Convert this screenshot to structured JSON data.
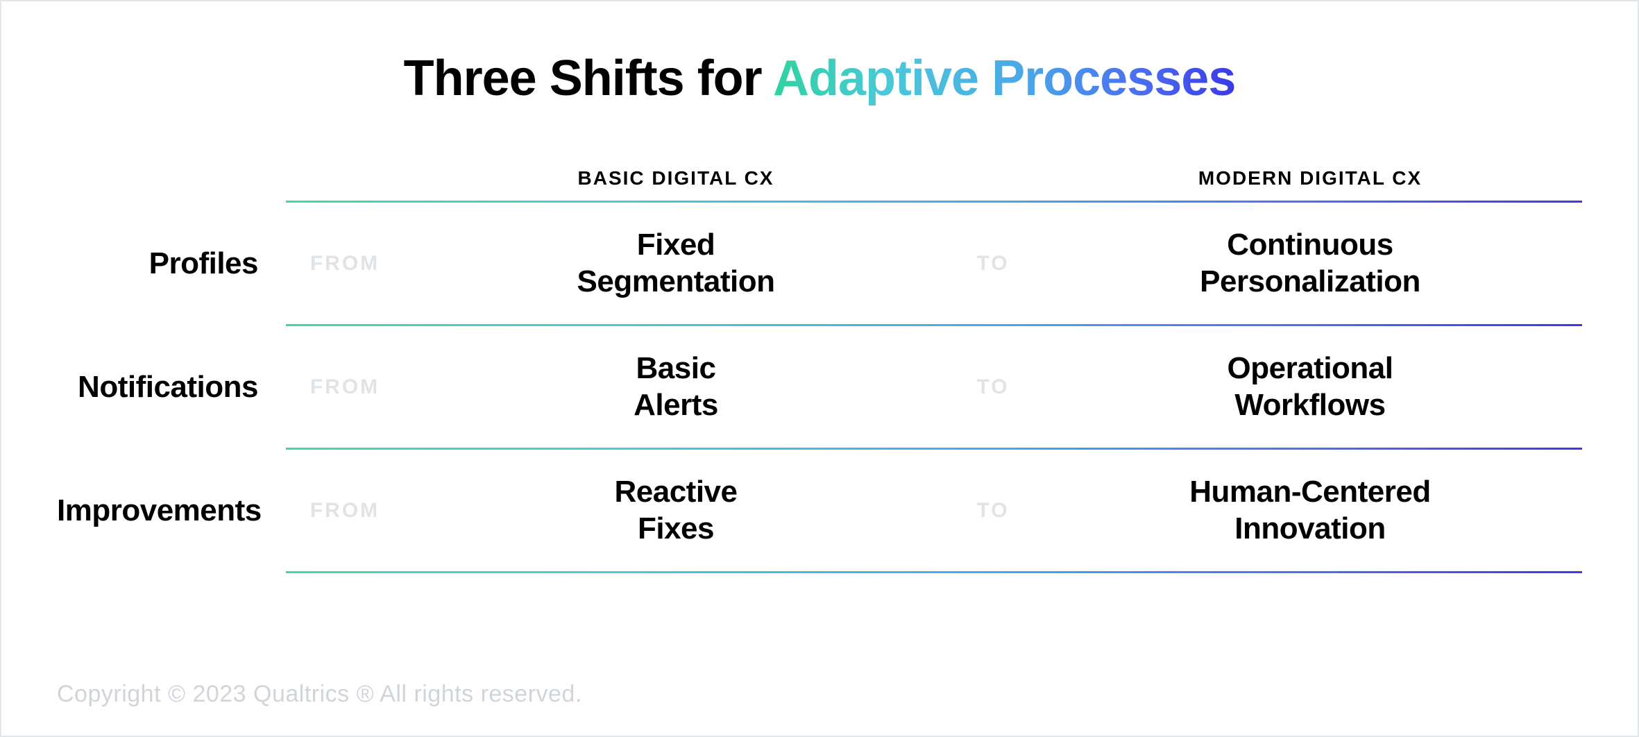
{
  "title_prefix": "Three Shifts for ",
  "title_highlight": "Adaptive Processes",
  "columns": {
    "basic": "BASIC DIGITAL CX",
    "modern": "MODERN DIGITAL CX"
  },
  "connectors": {
    "from": "FROM",
    "to": "TO"
  },
  "rows": [
    {
      "label": "Profiles",
      "from_line1": "Fixed",
      "from_line2": "Segmentation",
      "to_line1": "Continuous",
      "to_line2": "Personalization"
    },
    {
      "label": "Notifications",
      "from_line1": "Basic",
      "from_line2": "Alerts",
      "to_line1": "Operational",
      "to_line2": "Workflows"
    },
    {
      "label": "Improvements",
      "from_line1": "Reactive",
      "from_line2": "Fixes",
      "to_line1": "Human-Centered",
      "to_line2": "Innovation"
    }
  ],
  "copyright": "Copyright © 2023 Qualtrics ® All rights reserved."
}
